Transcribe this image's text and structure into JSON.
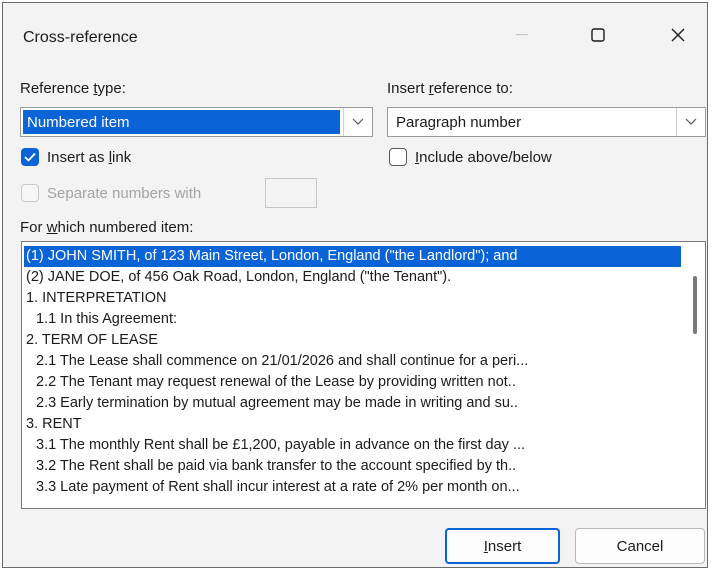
{
  "window": {
    "title": "Cross-reference"
  },
  "reference_type": {
    "label_pre": "Reference ",
    "label_key": "t",
    "label_post": "ype:",
    "value": "Numbered item"
  },
  "insert_reference_to": {
    "label_pre": "Insert ",
    "label_key": "r",
    "label_post": "eference to:",
    "value": "Paragraph number"
  },
  "checkboxes": {
    "insert_as_link": {
      "pre": "Insert as ",
      "key": "l",
      "post": "ink",
      "checked": true
    },
    "include_above_below": {
      "pre": "",
      "key": "I",
      "post": "nclude above/below",
      "checked": false
    },
    "separate_numbers": {
      "label": "Separate numbers with",
      "checked": false,
      "disabled": true
    }
  },
  "list": {
    "label_pre": "For ",
    "label_key": "w",
    "label_post": "hich numbered item:",
    "items": [
      {
        "text": "(1) JOHN SMITH, of 123 Main Street, London, England (\"the Landlord\"); and",
        "selected": true,
        "indent": false
      },
      {
        "text": "(2) JANE DOE, of 456 Oak Road, London, England (\"the Tenant\").",
        "selected": false,
        "indent": false
      },
      {
        "text": "1. INTERPRETATION",
        "selected": false,
        "indent": false
      },
      {
        "text": "1.1 In this Agreement:",
        "selected": false,
        "indent": true
      },
      {
        "text": "2. TERM OF LEASE",
        "selected": false,
        "indent": false
      },
      {
        "text": "2.1 The Lease shall commence on 21/01/2026 and shall continue for a peri...",
        "selected": false,
        "indent": true
      },
      {
        "text": "2.2 The Tenant may request renewal of the Lease by providing written not..",
        "selected": false,
        "indent": true
      },
      {
        "text": "2.3 Early termination by mutual agreement may be made in writing and su..",
        "selected": false,
        "indent": true
      },
      {
        "text": "3. RENT",
        "selected": false,
        "indent": false
      },
      {
        "text": "3.1 The monthly Rent shall be £1,200, payable in advance on the first day ...",
        "selected": false,
        "indent": true
      },
      {
        "text": "3.2 The Rent shall be paid via bank transfer to the account specified by th..",
        "selected": false,
        "indent": true
      },
      {
        "text": "3.3 Late payment of Rent shall incur interest at a rate of 2% per month on...",
        "selected": false,
        "indent": true
      }
    ]
  },
  "buttons": {
    "insert_key": "I",
    "insert_rest": "nsert",
    "cancel": "Cancel"
  },
  "colors": {
    "accent": "#0a64d8",
    "dialog_bg": "#f3f3f3"
  },
  "icons": {
    "minimize": "minimize-icon",
    "maximize": "maximize-icon",
    "close": "close-icon",
    "dropdown": "chevron-down-icon",
    "check": "checkmark-icon"
  }
}
